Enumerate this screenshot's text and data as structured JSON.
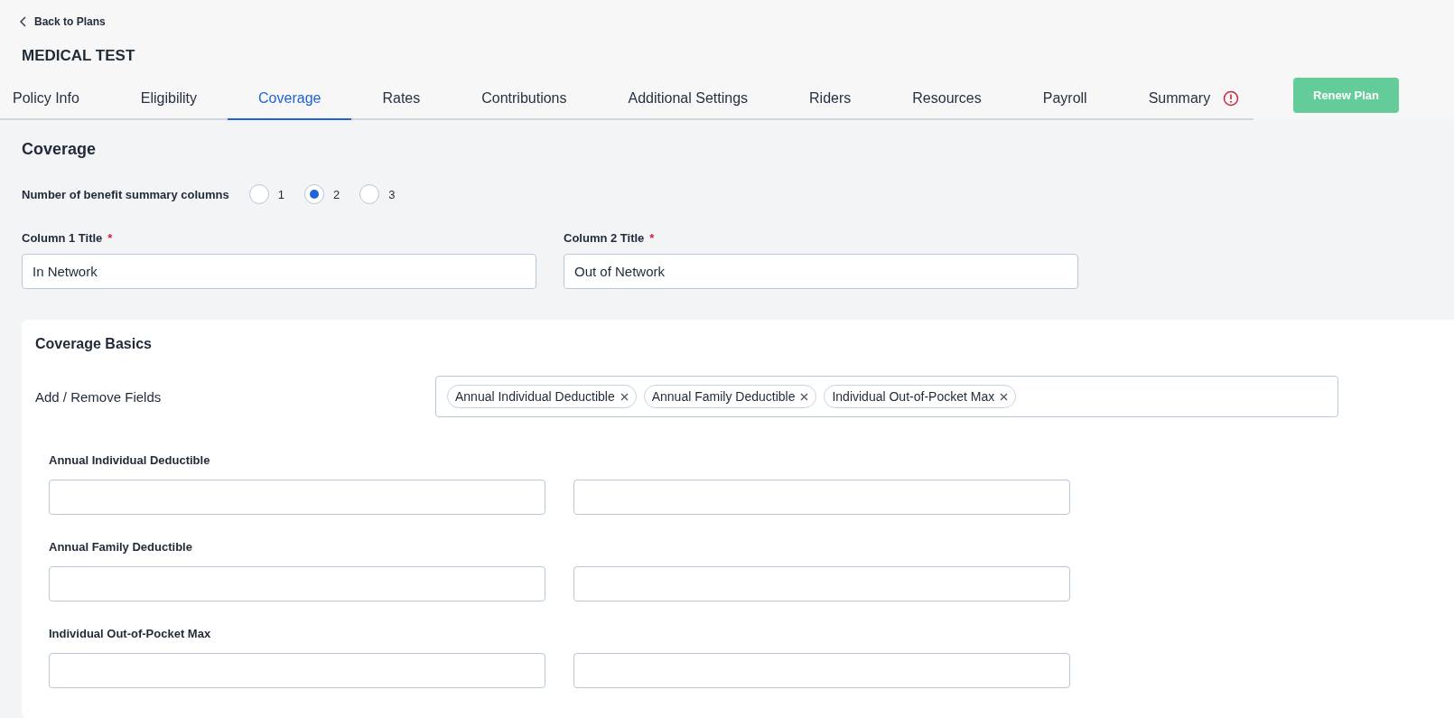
{
  "back_link": "Back to Plans",
  "plan_title": "MEDICAL TEST",
  "tabs": [
    {
      "label": "Policy Info",
      "selected": false,
      "alert": false
    },
    {
      "label": "Eligibility",
      "selected": false,
      "alert": false
    },
    {
      "label": "Coverage",
      "selected": true,
      "alert": false
    },
    {
      "label": "Rates",
      "selected": false,
      "alert": false
    },
    {
      "label": "Contributions",
      "selected": false,
      "alert": false
    },
    {
      "label": "Additional Settings",
      "selected": false,
      "alert": false
    },
    {
      "label": "Riders",
      "selected": false,
      "alert": false
    },
    {
      "label": "Resources",
      "selected": false,
      "alert": false
    },
    {
      "label": "Payroll",
      "selected": false,
      "alert": false
    },
    {
      "label": "Summary",
      "selected": false,
      "alert": true
    }
  ],
  "renew_button": "Renew Plan",
  "section_title": "Coverage",
  "columns_setting": {
    "label": "Number of benefit summary columns",
    "options": [
      {
        "label": "1",
        "selected": false
      },
      {
        "label": "2",
        "selected": true
      },
      {
        "label": "3",
        "selected": false
      }
    ]
  },
  "column_titles": [
    {
      "label": "Column 1 Title",
      "required_mark": "*",
      "value": "In Network"
    },
    {
      "label": "Column 2 Title",
      "required_mark": "*",
      "value": "Out of Network"
    }
  ],
  "card": {
    "title": "Coverage Basics",
    "fields_label": "Add / Remove Fields",
    "tags": [
      "Annual Individual Deductible",
      "Annual Family Deductible",
      "Individual Out-of-Pocket Max"
    ],
    "rows": [
      {
        "label": "Annual Individual Deductible"
      },
      {
        "label": "Annual Family Deductible"
      },
      {
        "label": "Individual Out-of-Pocket Max"
      }
    ]
  }
}
